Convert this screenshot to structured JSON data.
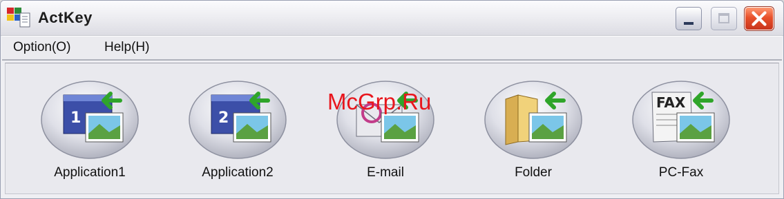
{
  "window": {
    "title": "ActKey"
  },
  "menu": [
    {
      "label": "Option(O)"
    },
    {
      "label": "Help(H)"
    }
  ],
  "tools": [
    {
      "label": "Application1",
      "icon": "application1-scan-icon",
      "badge": "1"
    },
    {
      "label": "Application2",
      "icon": "application2-scan-icon",
      "badge": "2"
    },
    {
      "label": "E-mail",
      "icon": "email-scan-icon"
    },
    {
      "label": "Folder",
      "icon": "folder-scan-icon"
    },
    {
      "label": "PC-Fax",
      "icon": "pc-fax-scan-icon",
      "badge": "FAX"
    }
  ],
  "watermark": "McGrp.Ru",
  "colors": {
    "arrow_green": "#2fa52a",
    "close_red": "#e8512b",
    "watermark_red": "#e8161d"
  }
}
